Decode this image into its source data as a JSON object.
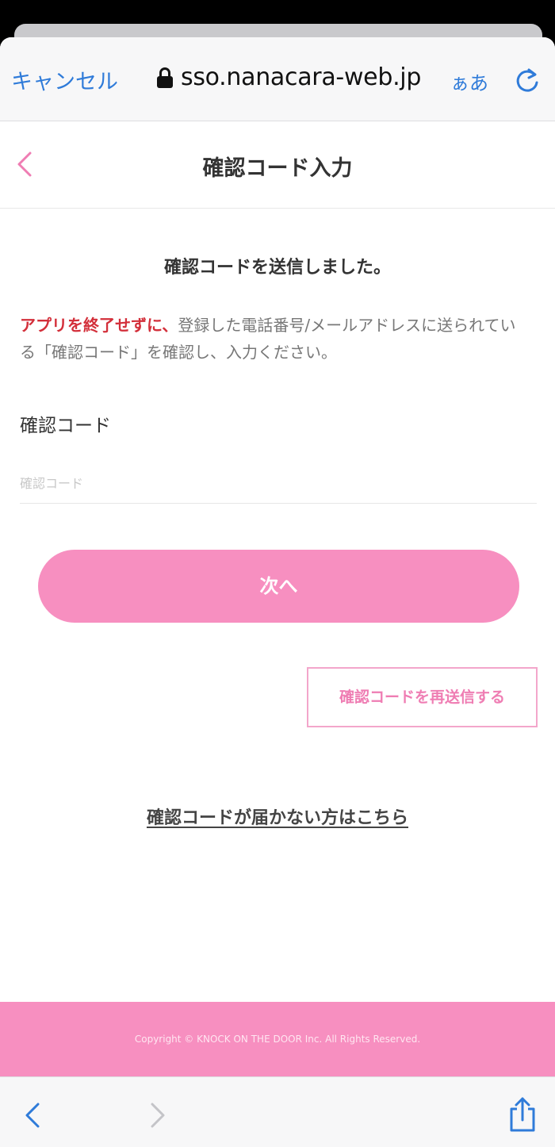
{
  "browser": {
    "cancel_label": "キャンセル",
    "url": "sso.nanacara-web.jp",
    "text_size_label": "ぁあ"
  },
  "page": {
    "title": "確認コード入力",
    "sent_message": "確認コードを送信しました。",
    "notice_warning": "アプリを終了せずに、",
    "notice_text": "登録した電話番号/メールアドレスに送られている「確認コード」を確認し、入力ください。",
    "code_label": "確認コード",
    "code_placeholder": "確認コード",
    "code_value": "",
    "next_label": "次へ",
    "resend_label": "確認コードを再送信する",
    "help_link": "確認コードが届かない方はこちら"
  },
  "footer": {
    "copyright": "Copyright © KNOCK ON THE DOOR Inc. All Rights Reserved."
  },
  "toolbar": {
    "icons": [
      "back-icon",
      "forward-icon",
      "share-icon"
    ]
  },
  "colors": {
    "accent": "#f78fc0",
    "link_blue": "#2f7bd9",
    "warning_red": "#d32f3a"
  }
}
